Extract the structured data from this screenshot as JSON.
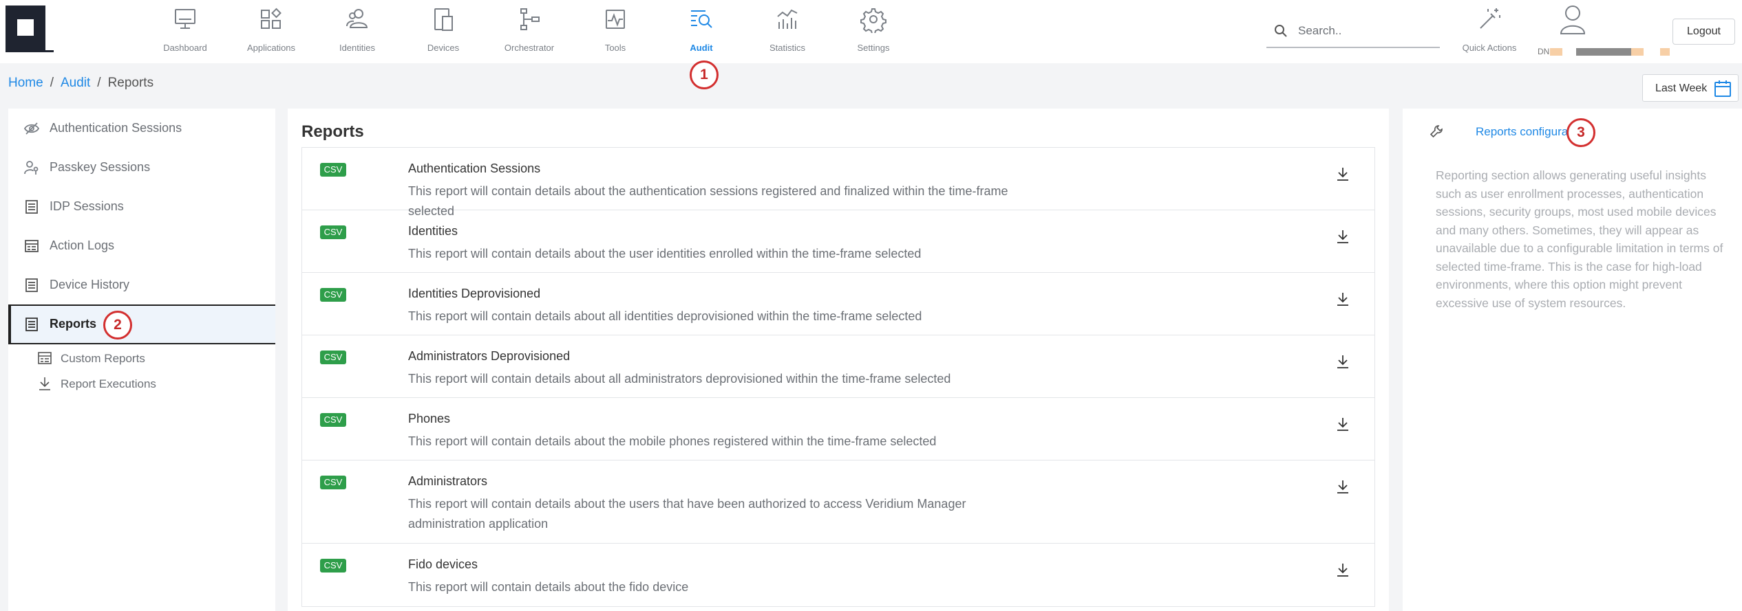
{
  "nav": {
    "items": [
      {
        "label": "Dashboard",
        "icon": "monitor-icon"
      },
      {
        "label": "Applications",
        "icon": "apps-icon"
      },
      {
        "label": "Identities",
        "icon": "users-icon"
      },
      {
        "label": "Devices",
        "icon": "devices-icon"
      },
      {
        "label": "Orchestrator",
        "icon": "orchestrator-icon"
      },
      {
        "label": "Tools",
        "icon": "tools-icon"
      },
      {
        "label": "Audit",
        "icon": "audit-icon",
        "active": true
      },
      {
        "label": "Statistics",
        "icon": "statistics-icon"
      },
      {
        "label": "Settings",
        "icon": "gear-icon"
      }
    ]
  },
  "search": {
    "placeholder": "Search.."
  },
  "quick_actions": {
    "label": "Quick Actions"
  },
  "user": {
    "dn_label": "DN"
  },
  "logout_label": "Logout",
  "breadcrumb": {
    "home": "Home",
    "audit": "Audit",
    "current": "Reports"
  },
  "time_filter": {
    "label": "Last Week"
  },
  "annotations": [
    "1",
    "2",
    "3"
  ],
  "sidebar": {
    "items": [
      {
        "label": "Authentication Sessions"
      },
      {
        "label": "Passkey Sessions"
      },
      {
        "label": "IDP Sessions"
      },
      {
        "label": "Action Logs"
      },
      {
        "label": "Device History"
      },
      {
        "label": "Reports",
        "active": true
      }
    ],
    "sub_items": [
      {
        "label": "Custom Reports"
      },
      {
        "label": "Report Executions"
      }
    ]
  },
  "main": {
    "title": "Reports",
    "reports": [
      {
        "format": "CSV",
        "title": "Authentication Sessions",
        "description": "This report will contain details about the authentication sessions registered and finalized within the time-frame selected"
      },
      {
        "format": "CSV",
        "title": "Identities",
        "description": "This report will contain details about the user identities enrolled within the time-frame selected"
      },
      {
        "format": "CSV",
        "title": "Identities Deprovisioned",
        "description": "This report will contain details about all identities deprovisioned within the time-frame selected"
      },
      {
        "format": "CSV",
        "title": "Administrators Deprovisioned",
        "description": "This report will contain details about all administrators deprovisioned within the time-frame selected"
      },
      {
        "format": "CSV",
        "title": "Phones",
        "description": "This report will contain details about the mobile phones registered within the time-frame selected"
      },
      {
        "format": "CSV",
        "title": "Administrators",
        "description": "This report will contain details about the users that have been authorized to access Veridium Manager administration application"
      },
      {
        "format": "CSV",
        "title": "Fido devices",
        "description": "This report will contain details about the fido device"
      }
    ]
  },
  "right_panel": {
    "config_link": "Reports configuration",
    "info": "Reporting section allows generating useful insights such as user enrollment processes, authentication sessions, security groups, most used mobile devices and many others. Sometimes, they will appear as unavailable due to a configurable limitation in terms of selected time-frame. This is the case for high-load environments, where this option might prevent excessive use of system resources."
  },
  "colors": {
    "accent": "#1e88e5",
    "csv_badge": "#2e9e4a",
    "annotation": "#d32f2f"
  }
}
